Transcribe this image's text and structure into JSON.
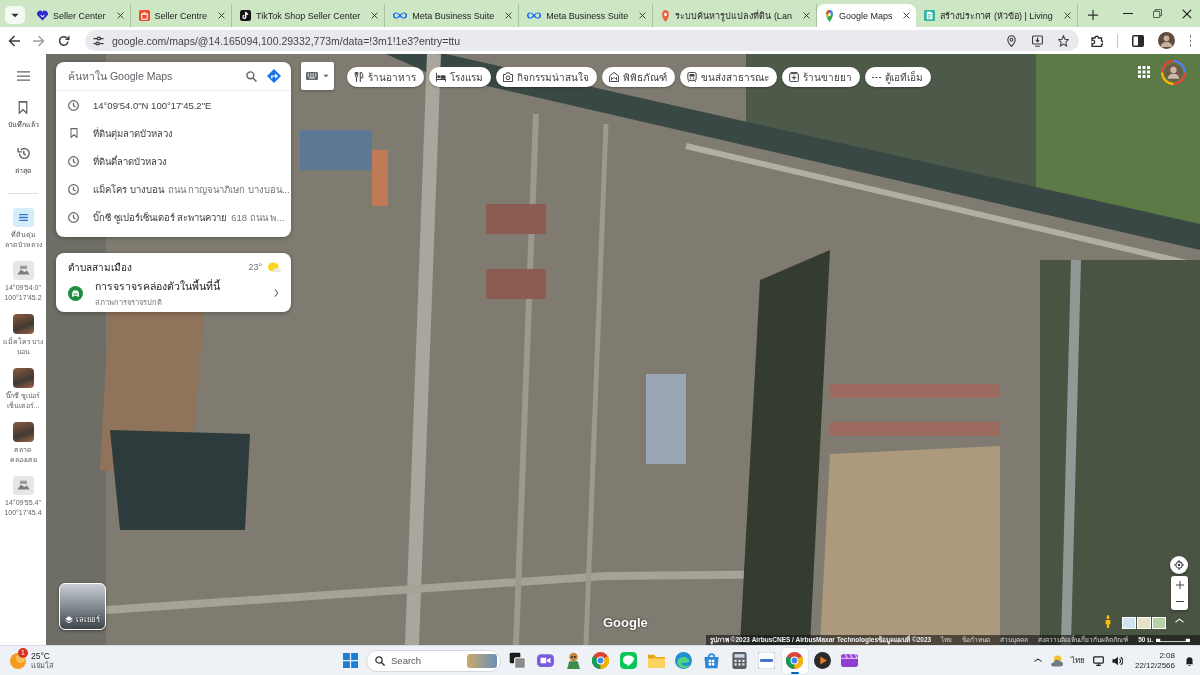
{
  "tab_strip": {
    "tabs": [
      {
        "kind": "heart",
        "title": "Seller Center",
        "selected": false
      },
      {
        "kind": "bag",
        "title": "Seller Centre",
        "selected": false
      },
      {
        "kind": "note",
        "title": "TikTok Shop Seller Center",
        "selected": false
      },
      {
        "kind": "infinity",
        "title": "Meta Business Suite",
        "selected": false
      },
      {
        "kind": "infinity",
        "title": "Meta Business Suite",
        "selected": false
      },
      {
        "kind": "pin",
        "title": "ระบบค้นหารูปแปลงที่ดิน (Lan",
        "selected": false
      },
      {
        "kind": "maps",
        "title": "Google Maps",
        "selected": true
      },
      {
        "kind": "page",
        "title": "สร้างประกาศ (หัวข้อ) | Living",
        "selected": false
      }
    ]
  },
  "toolbar": {
    "url": "google.com/maps/@14.165094,100.29332,773m/data=!3m1!1e3?entry=ttu"
  },
  "rail": {
    "items": [
      {
        "kind": "saved",
        "label": "บันทึกแล้ว"
      },
      {
        "kind": "recent",
        "label": "ล่าสุด"
      }
    ],
    "recent_places": [
      {
        "kind": "list",
        "label": "ที่ดินตุ่ม ลาดบัวหลวง"
      },
      {
        "kind": "coordinates",
        "label": "14°09'54.0\" 100°17'45.2"
      },
      {
        "kind": "photo",
        "label": "แม็คโคร บางบอน"
      },
      {
        "kind": "photo",
        "label": "บิ๊กซี ซูเปอร์ เซ็นเตอร์..."
      },
      {
        "kind": "photo",
        "label": "ตลาด คลองเตย"
      },
      {
        "kind": "coordinates",
        "label": "14°09'55.4\" 100°17'45.4"
      }
    ]
  },
  "search": {
    "placeholder": "ค้นหาใน Google Maps",
    "suggestions": [
      {
        "kind": "history",
        "title": "14°09'54.0\"N 100°17'45.2\"E"
      },
      {
        "kind": "saved",
        "title": "ที่ดินตุ่มลาดบัวหลวง"
      },
      {
        "kind": "history",
        "title": "ที่ดินตี๋ลาดบัวหลวง"
      },
      {
        "kind": "history",
        "title": "แม็คโคร บางบอน",
        "detail": "ถนน กาญจนาภิเษก บางบอน..."
      },
      {
        "kind": "history",
        "title": "บิ๊กซี ซูเปอร์เซ็นเตอร์ สะพานควาย",
        "detail": "618 ถนน พ..."
      }
    ]
  },
  "weather": {
    "place": "ตำบลสามเมือง",
    "temperature": "23°"
  },
  "traffic": {
    "title": "การจราจรคล่องตัวในพื้นที่นี้",
    "subtitle": "สภาพการจราจรปกติ"
  },
  "categories": [
    {
      "kind": "restaurant",
      "label": "ร้านอาหาร"
    },
    {
      "kind": "hotel",
      "label": "โรงแรม"
    },
    {
      "kind": "attraction",
      "label": "กิจกรรมน่าสนใจ"
    },
    {
      "kind": "museum",
      "label": "พิพิธภัณฑ์"
    },
    {
      "kind": "transit",
      "label": "ขนส่งสาธารณะ"
    },
    {
      "kind": "pharmacy",
      "label": "ร้านขายยา"
    },
    {
      "kind": "atm",
      "label": "ตู้เอทีเอ็ม"
    }
  ],
  "map": {
    "layers_label": "เลเยอร์",
    "logo": "Google",
    "imagery_credit": "รูปภาพ ©2023 AirbusCNES / AirbusMaxar Technologiesข้อมูลแผนที่ ©2023",
    "links": [
      "ไทย",
      "ข้อกำหนด",
      "ส่วนบุคคล",
      "ส่งความคิดเห็นเกี่ยวกับผลิตภัณฑ์"
    ],
    "scale": "50 ม."
  },
  "taskbar": {
    "weather": {
      "badge": "1",
      "temperature": "25°C",
      "condition": "แจ่มใส"
    },
    "search": {
      "placeholder": "Search"
    },
    "apps": [
      {
        "kind": "taskview",
        "selected": false
      },
      {
        "kind": "camera",
        "selected": false
      },
      {
        "kind": "game",
        "selected": false
      },
      {
        "kind": "browser",
        "selected": false
      },
      {
        "kind": "chat",
        "selected": false
      },
      {
        "kind": "folder",
        "selected": false
      },
      {
        "kind": "wave",
        "selected": false
      },
      {
        "kind": "store",
        "selected": false
      },
      {
        "kind": "calculator",
        "selected": false
      },
      {
        "kind": "tile",
        "selected": false
      },
      {
        "kind": "browser",
        "selected": true
      },
      {
        "kind": "player",
        "selected": false
      },
      {
        "kind": "video",
        "selected": false
      }
    ],
    "language": "ไทย",
    "time": "2:08",
    "date": "22/12/2566"
  }
}
